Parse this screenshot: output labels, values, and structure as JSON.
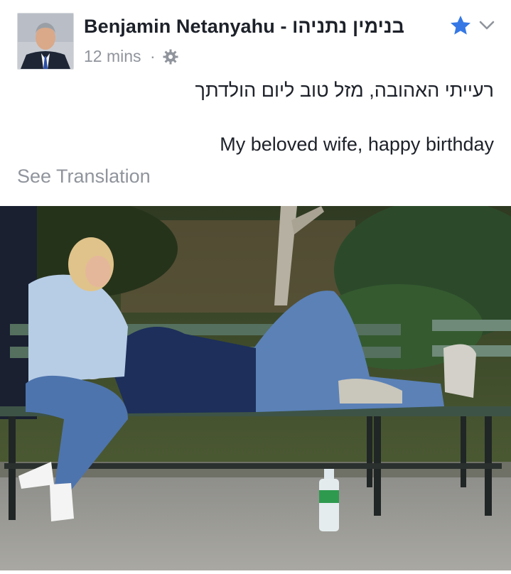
{
  "post": {
    "author": "Benjamin Netanyahu - בנימין נתניהו",
    "timestamp": "12 mins",
    "separator": "·",
    "privacy_icon": "gear-icon",
    "text_hebrew": "רעייתי האהובה, מזל טוב ליום הולדתך",
    "text_english": "My beloved wife, happy birthday",
    "see_translation": "See Translation"
  },
  "header_controls": {
    "favorite_icon": "star-icon",
    "menu_icon": "chevron-down-icon"
  },
  "colors": {
    "star": "#3578e5",
    "secondary_text": "#90949c",
    "primary_text": "#1d2129"
  },
  "photo": {
    "name": "birthday-photo",
    "objects": [
      "park-bench",
      "woman-sitting",
      "man-lying",
      "water-bottle"
    ]
  }
}
